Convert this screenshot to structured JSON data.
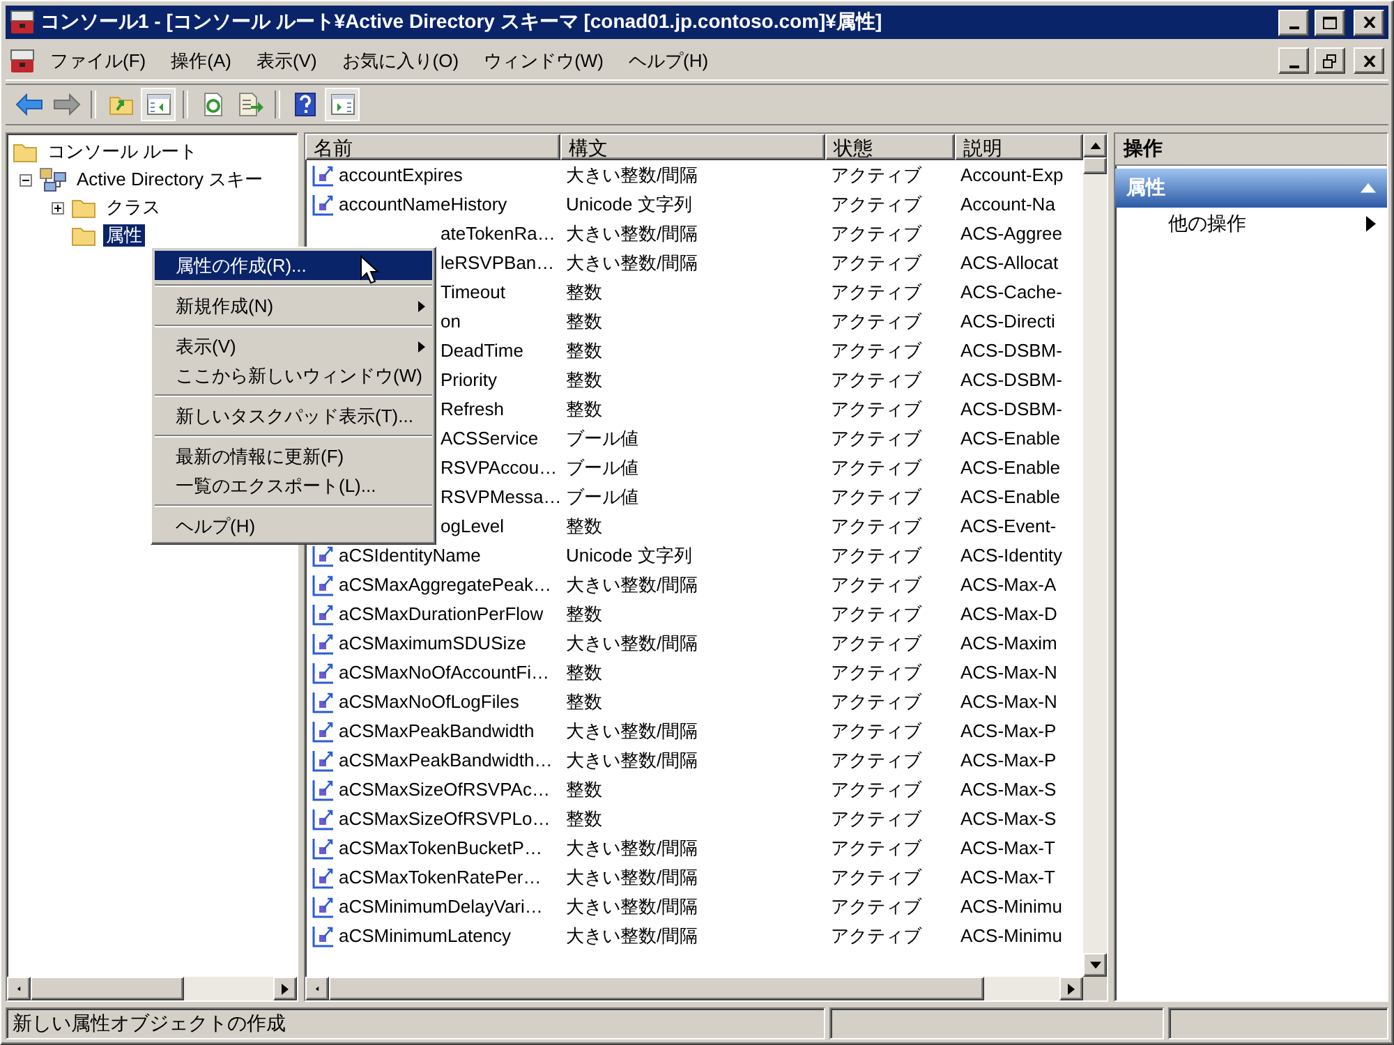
{
  "window": {
    "title": "コンソール1 - [コンソール ルート¥Active Directory スキーマ [conad01.jp.contoso.com]¥属性]"
  },
  "menubar": [
    "ファイル(F)",
    "操作(A)",
    "表示(V)",
    "お気に入り(O)",
    "ウィンドウ(W)",
    "ヘルプ(H)"
  ],
  "toolbar": [
    {
      "kind": "back",
      "pressed": false
    },
    {
      "kind": "forward",
      "pressed": false
    },
    {
      "kind": "separator"
    },
    {
      "kind": "up",
      "pressed": false
    },
    {
      "kind": "tree",
      "pressed": true
    },
    {
      "kind": "separator"
    },
    {
      "kind": "refresh",
      "pressed": false
    },
    {
      "kind": "export",
      "pressed": false
    },
    {
      "kind": "separator"
    },
    {
      "kind": "help",
      "pressed": false
    },
    {
      "kind": "actions",
      "pressed": true
    }
  ],
  "tree": [
    {
      "label": "コンソール ルート",
      "kind": "folder",
      "selected": false,
      "children": [
        {
          "label": "Active Directory スキー",
          "kind": "schema",
          "expanded": true,
          "selected": false,
          "children": [
            {
              "label": "クラス",
              "kind": "folder",
              "expanded": false,
              "selected": false
            },
            {
              "label": "属性",
              "kind": "folder",
              "selected": true
            }
          ]
        }
      ]
    }
  ],
  "table": {
    "columns": [
      "名前",
      "構文",
      "状態",
      "説明"
    ],
    "rows": [
      {
        "kind": "full",
        "cells": [
          "accountExpires",
          "大きい整数/間隔",
          "アクティブ",
          "Account-Exp"
        ]
      },
      {
        "kind": "full",
        "cells": [
          "accountNameHistory",
          "Unicode 文字列",
          "アクティブ",
          "Account-Na"
        ]
      },
      {
        "kind": "partial",
        "cells": [
          "ateTokenRa…",
          "大きい整数/間隔",
          "アクティブ",
          "ACS-Aggree"
        ]
      },
      {
        "kind": "partial",
        "cells": [
          "leRSVPBan…",
          "大きい整数/間隔",
          "アクティブ",
          "ACS-Allocat"
        ]
      },
      {
        "kind": "partial",
        "cells": [
          "Timeout",
          "整数",
          "アクティブ",
          "ACS-Cache-"
        ]
      },
      {
        "kind": "partial",
        "cells": [
          "on",
          "整数",
          "アクティブ",
          "ACS-Directi"
        ]
      },
      {
        "kind": "partial",
        "cells": [
          "DeadTime",
          "整数",
          "アクティブ",
          "ACS-DSBM-"
        ]
      },
      {
        "kind": "partial",
        "cells": [
          "Priority",
          "整数",
          "アクティブ",
          "ACS-DSBM-"
        ]
      },
      {
        "kind": "partial",
        "cells": [
          "Refresh",
          "整数",
          "アクティブ",
          "ACS-DSBM-"
        ]
      },
      {
        "kind": "partial",
        "cells": [
          "ACSService",
          "ブール値",
          "アクティブ",
          "ACS-Enable"
        ]
      },
      {
        "kind": "partial",
        "cells": [
          "RSVPAccou…",
          "ブール値",
          "アクティブ",
          "ACS-Enable"
        ]
      },
      {
        "kind": "partial",
        "cells": [
          "RSVPMessa…",
          "ブール値",
          "アクティブ",
          "ACS-Enable"
        ]
      },
      {
        "kind": "partial",
        "cells": [
          "ogLevel",
          "整数",
          "アクティブ",
          "ACS-Event-"
        ]
      },
      {
        "kind": "full",
        "cells": [
          "aCSIdentityName",
          "Unicode 文字列",
          "アクティブ",
          "ACS-Identity"
        ]
      },
      {
        "kind": "full",
        "cells": [
          "aCSMaxAggregatePeak…",
          "大きい整数/間隔",
          "アクティブ",
          "ACS-Max-A"
        ]
      },
      {
        "kind": "full",
        "cells": [
          "aCSMaxDurationPerFlow",
          "整数",
          "アクティブ",
          "ACS-Max-D"
        ]
      },
      {
        "kind": "full",
        "cells": [
          "aCSMaximumSDUSize",
          "大きい整数/間隔",
          "アクティブ",
          "ACS-Maxim"
        ]
      },
      {
        "kind": "full",
        "cells": [
          "aCSMaxNoOfAccountFi…",
          "整数",
          "アクティブ",
          "ACS-Max-N"
        ]
      },
      {
        "kind": "full",
        "cells": [
          "aCSMaxNoOfLogFiles",
          "整数",
          "アクティブ",
          "ACS-Max-N"
        ]
      },
      {
        "kind": "full",
        "cells": [
          "aCSMaxPeakBandwidth",
          "大きい整数/間隔",
          "アクティブ",
          "ACS-Max-P"
        ]
      },
      {
        "kind": "full",
        "cells": [
          "aCSMaxPeakBandwidth…",
          "大きい整数/間隔",
          "アクティブ",
          "ACS-Max-P"
        ]
      },
      {
        "kind": "full",
        "cells": [
          "aCSMaxSizeOfRSVPAc…",
          "整数",
          "アクティブ",
          "ACS-Max-S"
        ]
      },
      {
        "kind": "full",
        "cells": [
          "aCSMaxSizeOfRSVPLo…",
          "整数",
          "アクティブ",
          "ACS-Max-S"
        ]
      },
      {
        "kind": "full",
        "cells": [
          "aCSMaxTokenBucketP…",
          "大きい整数/間隔",
          "アクティブ",
          "ACS-Max-T"
        ]
      },
      {
        "kind": "full",
        "cells": [
          "aCSMaxTokenRatePer…",
          "大きい整数/間隔",
          "アクティブ",
          "ACS-Max-T"
        ]
      },
      {
        "kind": "full",
        "cells": [
          "aCSMinimumDelayVari…",
          "大きい整数/間隔",
          "アクティブ",
          "ACS-Minimu"
        ]
      },
      {
        "kind": "full",
        "cells": [
          "aCSMinimumLatency",
          "大きい整数/間隔",
          "アクティブ",
          "ACS-Minimu"
        ]
      }
    ]
  },
  "actions": {
    "title": "操作",
    "section": {
      "title": "属性",
      "expanded": true
    },
    "items": [
      {
        "label": "他の操作",
        "submenu": true
      }
    ]
  },
  "context_menu": [
    {
      "kind": "item",
      "label": "属性の作成(R)...",
      "selected": true,
      "submenu": false
    },
    {
      "kind": "separator"
    },
    {
      "kind": "item",
      "label": "新規作成(N)",
      "selected": false,
      "submenu": true
    },
    {
      "kind": "separator"
    },
    {
      "kind": "item",
      "label": "表示(V)",
      "selected": false,
      "submenu": true
    },
    {
      "kind": "item",
      "label": "ここから新しいウィンドウ(W)",
      "selected": false,
      "submenu": false
    },
    {
      "kind": "separator"
    },
    {
      "kind": "item",
      "label": "新しいタスクパッド表示(T)...",
      "selected": false,
      "submenu": false
    },
    {
      "kind": "separator"
    },
    {
      "kind": "item",
      "label": "最新の情報に更新(F)",
      "selected": false,
      "submenu": false
    },
    {
      "kind": "item",
      "label": "一覧のエクスポート(L)...",
      "selected": false,
      "submenu": false
    },
    {
      "kind": "separator"
    },
    {
      "kind": "item",
      "label": "ヘルプ(H)",
      "selected": false,
      "submenu": false
    }
  ],
  "status_bar": [
    "新しい属性オブジェクトの作成"
  ]
}
